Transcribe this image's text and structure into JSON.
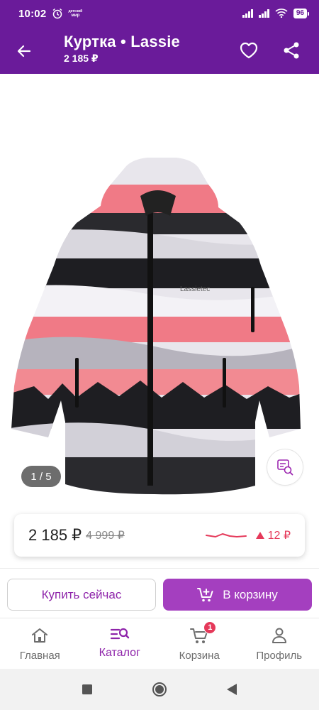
{
  "status_bar": {
    "time": "10:02",
    "brand_line1": "детский",
    "brand_line2": "мир",
    "battery": "96"
  },
  "header": {
    "title": "Куртка • Lassie",
    "price": "2 185 ₽"
  },
  "gallery": {
    "page_indicator": "1 / 5",
    "image_label_brand": "Lassietec"
  },
  "price_card": {
    "current_price": "2 185 ₽",
    "old_price": "4 999 ₽",
    "price_change": "12 ₽"
  },
  "actions": {
    "buy_now": "Купить сейчас",
    "add_to_cart": "В корзину"
  },
  "bottom_nav": {
    "items": [
      {
        "label": "Главная",
        "icon": "home-icon"
      },
      {
        "label": "Каталог",
        "icon": "catalog-search-icon",
        "active": true
      },
      {
        "label": "Корзина",
        "icon": "cart-icon",
        "badge": "1"
      },
      {
        "label": "Профиль",
        "icon": "profile-icon"
      }
    ]
  },
  "colors": {
    "primary": "#6a1b9a",
    "accent": "#8e24aa",
    "button_fill": "#a43fbf",
    "price_up": "#e5395a"
  }
}
